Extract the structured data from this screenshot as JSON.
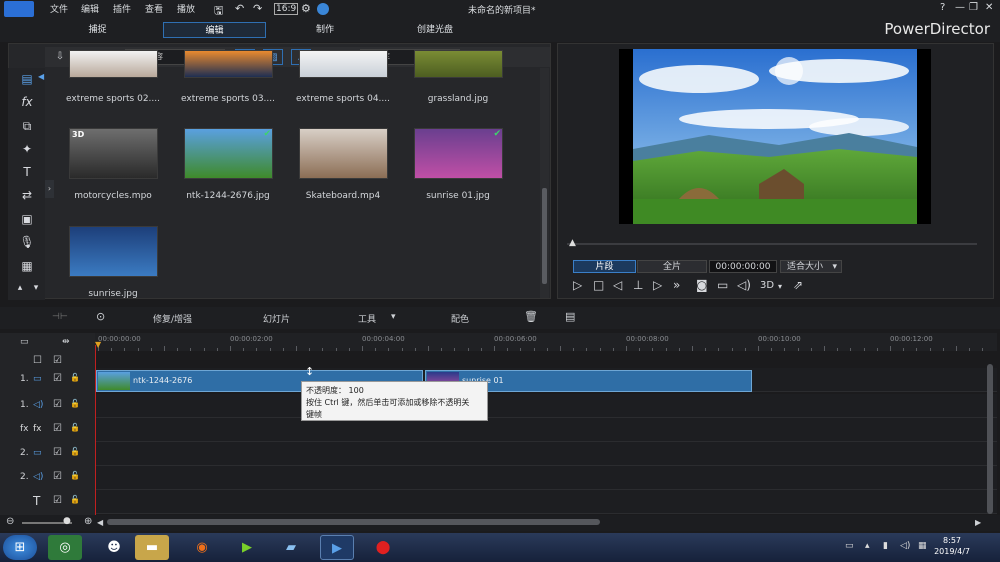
{
  "menu": {
    "items": [
      "文件",
      "编辑",
      "插件",
      "查看",
      "播放"
    ]
  },
  "window": {
    "title": "未命名的新项目*",
    "help": "?",
    "minimize": "—",
    "restore": "❐",
    "close": "✕"
  },
  "modes": {
    "tabs": [
      "捕捉",
      "编辑",
      "制作",
      "创建光盘"
    ],
    "active": 1
  },
  "brand": "PowerDirector",
  "library": {
    "dropdown": "媒体内容",
    "search_placeholder": "搜索库",
    "items": [
      {
        "label": "extreme sports 02....",
        "colors": [
          "#f2f2f2",
          "#b8a89a"
        ]
      },
      {
        "label": "extreme sports 03....",
        "colors": [
          "#e98a2f",
          "#1e2e52"
        ]
      },
      {
        "label": "extreme sports 04....",
        "colors": [
          "#f4f4f4",
          "#c9d0d8"
        ]
      },
      {
        "label": "grassland.jpg",
        "colors": [
          "#7a8c34",
          "#4d5e21"
        ]
      },
      {
        "label": "motorcycles.mpo",
        "colors": [
          "#6e6e6e",
          "#2a2a2a"
        ],
        "badge": "3D"
      },
      {
        "label": "ntk-1244-2676.jpg",
        "colors": [
          "#5aa0e0",
          "#3f8a2a"
        ],
        "checked": true
      },
      {
        "label": "Skateboard.mp4",
        "colors": [
          "#d8cfc6",
          "#8c6e55"
        ]
      },
      {
        "label": "sunrise 01.jpg",
        "colors": [
          "#6a3f8f",
          "#c04fa6"
        ],
        "checked": true
      },
      {
        "label": "sunrise.jpg",
        "colors": [
          "#1d3f7a",
          "#3b7bc2"
        ]
      }
    ]
  },
  "preview": {
    "btn_clip": "片段",
    "btn_full": "全片",
    "timecode": "00:00:00:00",
    "fit": "适合大小",
    "mode3d": "3D"
  },
  "toolbar": {
    "fix": "修复/增强",
    "slideshow": "幻灯片",
    "tools": "工具",
    "color": "配色"
  },
  "timeline": {
    "ticks": [
      "00:00:00:00",
      "00:00:02:00",
      "00:00:04:00",
      "00:00:06:00",
      "00:00:08:00",
      "00:00:10:00",
      "00:00:12:00"
    ],
    "tracks": [
      {
        "label": "1."
      },
      {
        "label": "1."
      },
      {
        "label": "fx"
      },
      {
        "label": "2."
      },
      {
        "label": "2."
      },
      {
        "label": "T"
      }
    ],
    "clips": [
      {
        "name": "ntk-1244-2676"
      },
      {
        "name": "sunrise 01"
      }
    ],
    "tooltip": {
      "line1": "不透明度： 100",
      "line2": "按住 Ctrl 键，然后单击可添加或移除不透明关",
      "line3": "键帧"
    }
  },
  "taskbar": {
    "time": "8:57",
    "date": "2019/4/7"
  }
}
